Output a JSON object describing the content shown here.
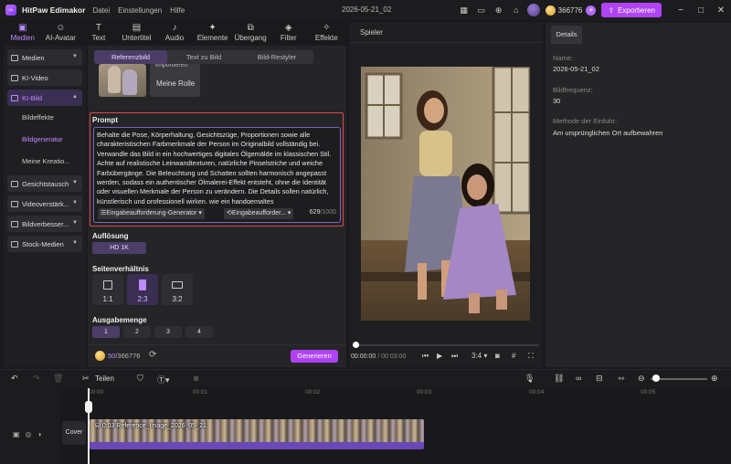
{
  "app": {
    "name": "HitPaw Edimakor",
    "menu": [
      "Datei",
      "Einstellungen",
      "Hilfe"
    ],
    "project_title": "2026-05-21_02",
    "credits": "366776",
    "export_label": "Exportieren"
  },
  "top_tabs": [
    {
      "label": "Medien",
      "icon": "▣",
      "active": true
    },
    {
      "label": "AI-Avatar",
      "icon": "☺",
      "active": false
    },
    {
      "label": "Text",
      "icon": "T",
      "active": false
    },
    {
      "label": "Untertitel",
      "icon": "▤",
      "active": false
    },
    {
      "label": "Audio",
      "icon": "♪",
      "active": false
    },
    {
      "label": "Elemente",
      "icon": "✦",
      "active": false
    },
    {
      "label": "Übergang",
      "icon": "⧉",
      "active": false
    },
    {
      "label": "Filter",
      "icon": "◈",
      "active": false
    },
    {
      "label": "Effekte",
      "icon": "✧",
      "active": false
    }
  ],
  "sidebar": {
    "items": [
      {
        "label": "Medien"
      },
      {
        "label": "KI-Video"
      },
      {
        "label": "KI-Bild"
      },
      {
        "label": "Gesichtstausch"
      },
      {
        "label": "Videoverstärk..."
      },
      {
        "label": "Bildverbesser..."
      },
      {
        "label": "Stock-Medien"
      }
    ],
    "subitems": [
      {
        "label": "Bildeffekte"
      },
      {
        "label": "Bildgenerator"
      },
      {
        "label": "Meine Kreatio..."
      }
    ]
  },
  "generator": {
    "tabs": [
      "Referenzbild",
      "Text zu Bild",
      "Bild-Restyler"
    ],
    "role_card": {
      "top_text": "Importieren",
      "label": "Meine Rolle"
    },
    "prompt_title": "Prompt",
    "prompt_text": "Behalte die Pose, Körperhaltung, Gesichtszüge, Proportionen sowie alle charakteristischen Farbmerkmale der Person im Originalbild vollständig bei. Verwandle das Bild in ein hochwertiges digitales Ölgemälde im klassischen Stil. Achte auf realistische Leinwandtexturen, natürliche Pinselstriche und weiche Farbübergänge. Die Beleuchtung und Schatten sollten harmonisch angepasst werden, sodass ein authentischer Ölmalerei-Effekt entsteht, ohne die Identität oder visuellen Merkmale der Person zu verändern. Die Details sollen natürlich, künstlerisch und professionell wirken, wie ein handgemaltes",
    "prompt_gen_label": "Eingabeaufforderung-Generator",
    "prompt_gen2_label": "Eingabeaufforder...",
    "char_count": "629",
    "char_max": "/1000",
    "resolution_title": "Auflösung",
    "resolution_value": "HD 1K",
    "ratio_title": "Seitenverhältnis",
    "ratios": [
      "1:1",
      "2:3",
      "3:2"
    ],
    "output_title": "Ausgabemenge",
    "counts": [
      "1",
      "2",
      "3",
      "4"
    ],
    "footer_used": "50",
    "footer_total": "/366776",
    "generate_label": "Generieren"
  },
  "player": {
    "title": "Spieler",
    "time_current": "00:00:00",
    "time_total": " / 00:03:00",
    "ratio_label": "3:4"
  },
  "details": {
    "tab": "Details",
    "name_label": "Name:",
    "name_value": "2026-05-21_02",
    "fps_label": "Bildfrequenz:",
    "fps_value": "30",
    "method_label": "Methode der Einfuhr:",
    "method_value": "Am ursprünglichen Ort aufbewahren"
  },
  "timeline": {
    "split_label": "Teilen",
    "ruler": [
      "00:00",
      "00:01",
      "00:02",
      "00:03",
      "00:04",
      "00:05"
    ],
    "cover_label": "Cover",
    "clip_label": "0:03 Reference_Image_2026_05_21"
  }
}
